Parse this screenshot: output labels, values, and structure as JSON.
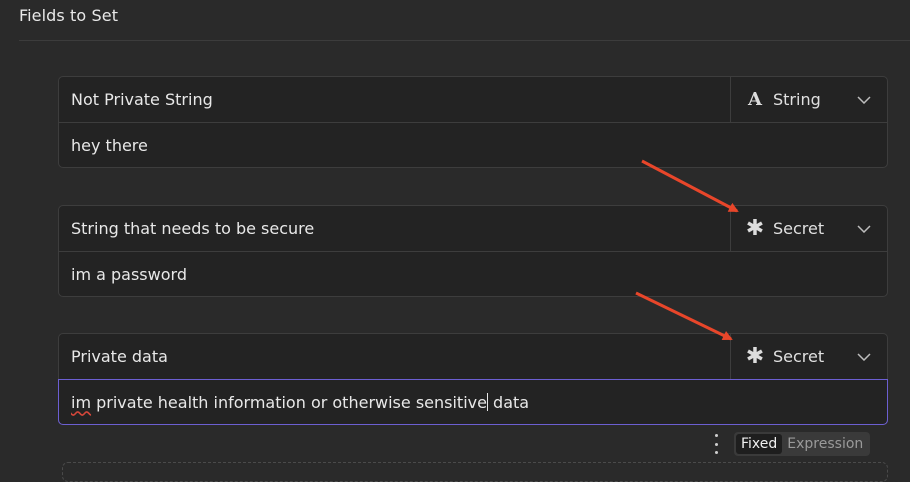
{
  "section": {
    "title": "Fields to Set"
  },
  "fields": [
    {
      "name": "Not Private String",
      "type": "String",
      "type_icon": "string-type-icon",
      "value": "hey there"
    },
    {
      "name": "String that needs to be secure",
      "type": "Secret",
      "type_icon": "secret-asterisk-icon",
      "value": "im a password"
    },
    {
      "name": "Private data",
      "type": "Secret",
      "type_icon": "secret-asterisk-icon",
      "value_misspelled": "im",
      "value_rest": " private health information or otherwise sensitive",
      "value_after_caret": " data"
    }
  ],
  "mode_toggle": {
    "fixed": "Fixed",
    "expression": "Expression",
    "selected": "Fixed"
  },
  "colors": {
    "annotation_arrow": "#e8462a",
    "focus_border": "#6c5fd2"
  }
}
